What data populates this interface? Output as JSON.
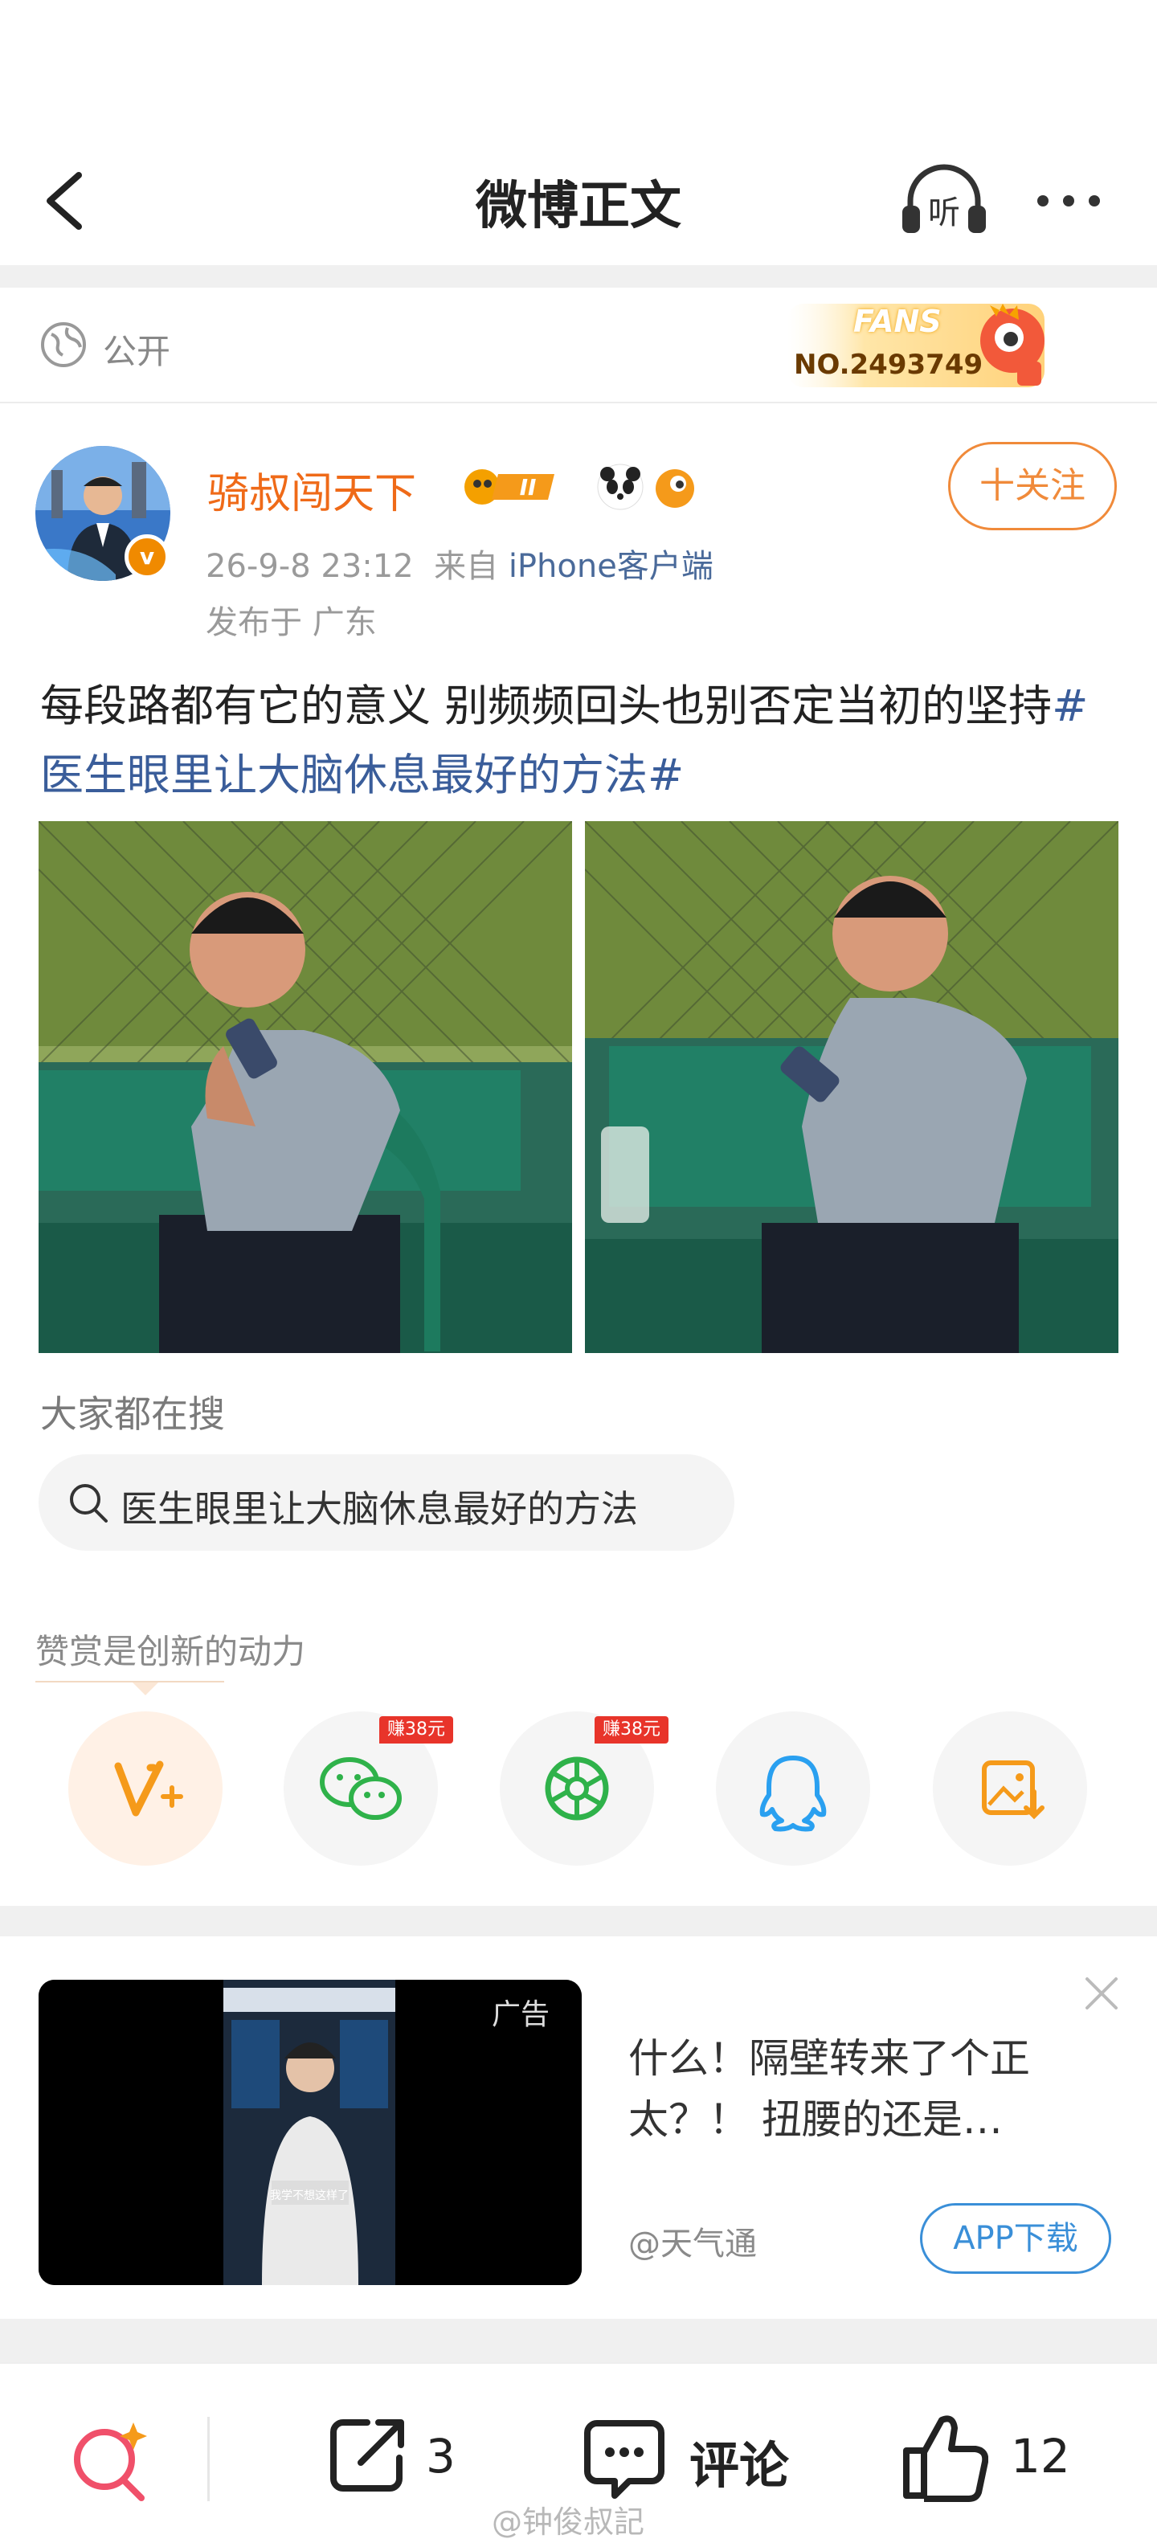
{
  "header": {
    "title": "微博正文",
    "listen_icon": "headphones-icon",
    "more_icon": "more-icon"
  },
  "visibility": {
    "label": "公开"
  },
  "fans_badge": {
    "title": "FANS",
    "number": "NO.2493749"
  },
  "author": {
    "name": "骑叔闯天下",
    "badge_level": "II",
    "follow_label": "十关注",
    "time": "26-9-8 23:12",
    "from_prefix": "来自",
    "source": "iPhone客户端",
    "location": "发布于 广东"
  },
  "post": {
    "text": "每段路都有它的意义 别频频回头也别否定当初的坚持",
    "hashtag": "#医生眼里让大脑休息最好的方法#"
  },
  "search": {
    "title": "大家都在搜",
    "query": "医生眼里让大脑休息最好的方法"
  },
  "reward": {
    "title": "赞赏是创新的动力",
    "wechat_tag": "赚38元",
    "moments_tag": "赚38元"
  },
  "ad": {
    "label": "广告",
    "video_caption": "我学不想这样了",
    "title": "什么！隔壁转来了个正太？！ 扭腰的还是…",
    "source": "@天气通",
    "button": "APP下载"
  },
  "bottom_bar": {
    "repost_count": "3",
    "comment_label": "评论",
    "like_count": "12",
    "watermark": "@钟俊叔記"
  },
  "colors": {
    "brand_orange": "#ef6a18",
    "link_blue": "#3a5d9a",
    "download_blue": "#3a8fd8"
  }
}
